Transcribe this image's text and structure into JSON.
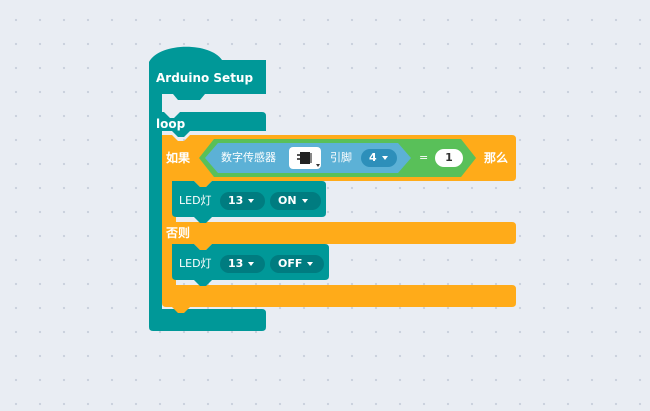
{
  "setup_block": {
    "title": "Arduino Setup"
  },
  "loop_block": {
    "title": "loop"
  },
  "if_block": {
    "if_label": "如果",
    "then_label": "那么",
    "else_label": "否则"
  },
  "condition": {
    "sensor_label": "数字传感器",
    "sensor_icon": "sensor-module-icon",
    "pin_label": "引脚",
    "pin_value": "4",
    "operator": "=",
    "compare_value": "1"
  },
  "led_then": {
    "label": "LED灯",
    "pin": "13",
    "state": "ON"
  },
  "led_else": {
    "label": "LED灯",
    "pin": "13",
    "state": "OFF"
  },
  "colors": {
    "arduino_teal": "#009898",
    "control_orange": "#ffab19",
    "logic_green": "#59c059",
    "sensor_blue": "#5cb1d6",
    "dropdown_dark": "#007c80",
    "canvas_bg": "#e9edf3"
  }
}
